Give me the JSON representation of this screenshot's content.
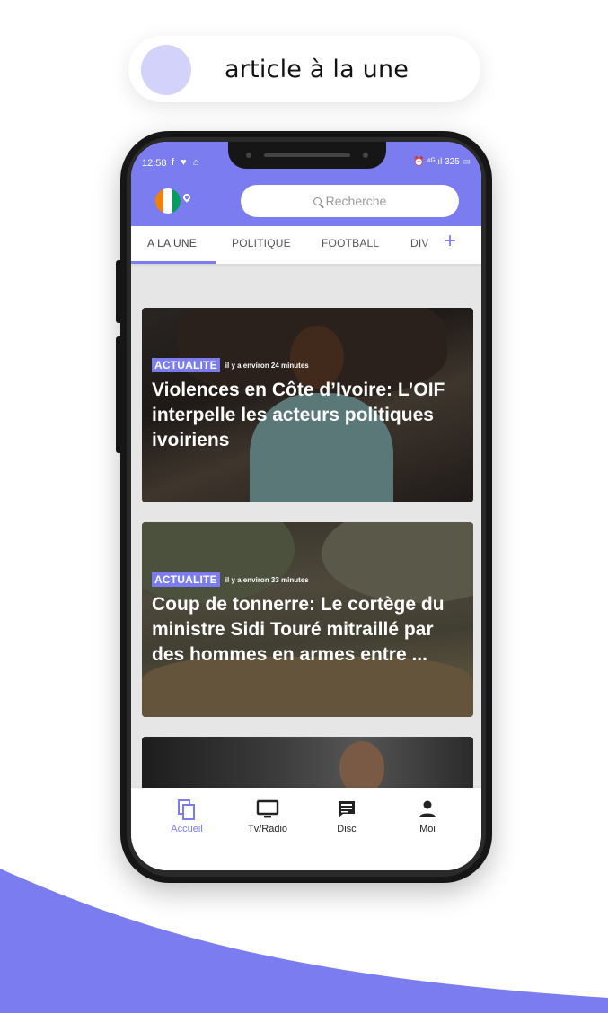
{
  "promo": {
    "caption": "article à la une",
    "accent": "#7b7cf0",
    "dot_color": "#d3d2fb"
  },
  "status_bar": {
    "time": "12:58",
    "icons": "f ♥ ⌂",
    "right": "⏰ ⁴ᴳ.ıl 325 ▭"
  },
  "header": {
    "search_placeholder": "Recherche",
    "flag_colors": [
      "#f77f00",
      "#ffffff",
      "#009e60"
    ]
  },
  "tabs": {
    "items": [
      {
        "label": "A LA UNE",
        "active": true
      },
      {
        "label": "POLITIQUE",
        "active": false
      },
      {
        "label": "FOOTBALL",
        "active": false
      },
      {
        "label": "DIV",
        "active": false
      }
    ],
    "add_label": "+"
  },
  "articles": [
    {
      "category": "ACTUALITE",
      "time": "il y a environ 24 minutes",
      "title": "Violences en Côte d’Ivoire: L’OIF interpelle les acteurs politiques ivoiriens"
    },
    {
      "category": "ACTUALITE",
      "time": "il y a environ 33 minutes",
      "title": "Coup de tonnerre: Le cortège du ministre Sidi Touré mitraillé par des hommes en armes   entre ..."
    }
  ],
  "bottom_nav": [
    {
      "label": "Accueil",
      "icon": "copy-icon",
      "active": true
    },
    {
      "label": "Tv/Radio",
      "icon": "tv-icon",
      "active": false
    },
    {
      "label": "Disc",
      "icon": "chat-icon",
      "active": false
    },
    {
      "label": "Moi",
      "icon": "person-icon",
      "active": false
    }
  ]
}
